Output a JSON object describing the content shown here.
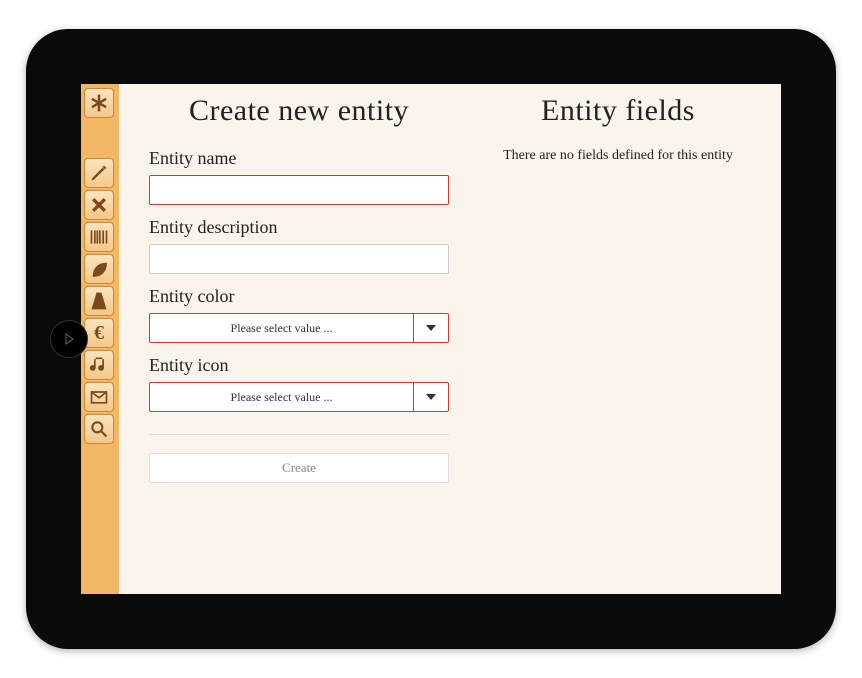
{
  "sidebar": {
    "items": [
      {
        "name": "asterisk-icon"
      },
      {
        "name": "pencil-icon"
      },
      {
        "name": "close-icon"
      },
      {
        "name": "barcode-icon"
      },
      {
        "name": "leaf-icon"
      },
      {
        "name": "road-icon"
      },
      {
        "name": "euro-icon"
      },
      {
        "name": "music-icon"
      },
      {
        "name": "mail-icon"
      },
      {
        "name": "search-icon"
      }
    ]
  },
  "left": {
    "heading": "Create new entity",
    "fields": {
      "name_label": "Entity name",
      "name_value": "",
      "description_label": "Entity description",
      "description_value": "",
      "color_label": "Entity color",
      "color_placeholder": "Please select value ...",
      "icon_label": "Entity icon",
      "icon_placeholder": "Please select value ..."
    },
    "submit_label": "Create"
  },
  "right": {
    "heading": "Entity fields",
    "empty_message": "There are no fields defined for this entity"
  },
  "colors": {
    "sidebar_bg": "#f3b664",
    "error_border": "#d9362e",
    "screen_bg": "#faf4ec"
  }
}
